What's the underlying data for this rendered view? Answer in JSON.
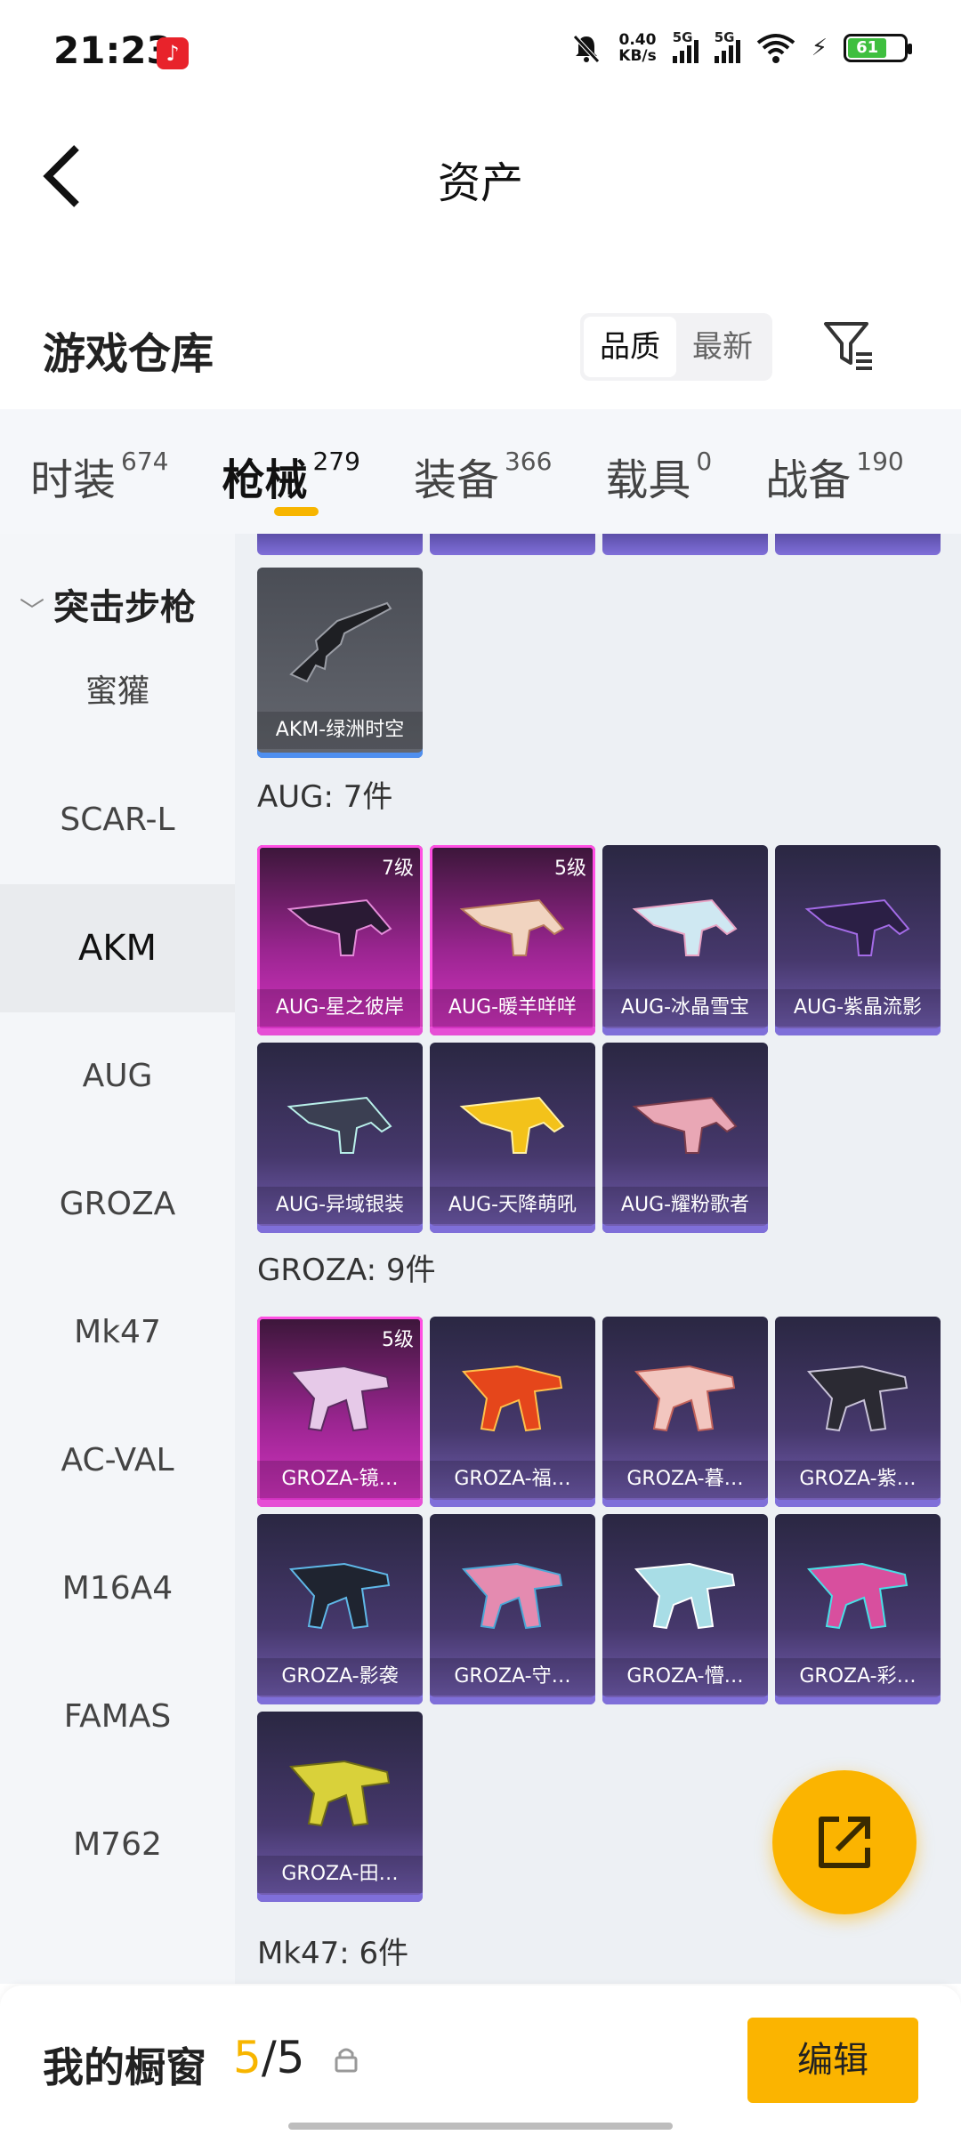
{
  "status_bar": {
    "time": "21:23",
    "net_speed_value": "0.40",
    "net_speed_unit": "KB/s",
    "sim1_label": "5G",
    "sim2_label": "5G",
    "battery_level": "61"
  },
  "header": {
    "title": "资产"
  },
  "warehouse": {
    "title": "游戏仓库",
    "sort_options": [
      "品质",
      "最新"
    ],
    "sort_selected": "品质"
  },
  "tabs": [
    {
      "label": "时装",
      "count": "674"
    },
    {
      "label": "枪械",
      "count": "279"
    },
    {
      "label": "装备",
      "count": "366"
    },
    {
      "label": "载具",
      "count": "0"
    },
    {
      "label": "战备",
      "count": "190"
    }
  ],
  "active_tab": "枪械",
  "categories": {
    "group_title": "突击步枪",
    "items": [
      "蜜獾",
      "SCAR-L",
      "AKM",
      "AUG",
      "GROZA",
      "Mk47",
      "AC-VAL",
      "M16A4",
      "FAMAS",
      "M762"
    ],
    "active": "AKM"
  },
  "sections": [
    {
      "items": [
        {
          "name": "AKM-绿洲时空",
          "level": ""
        }
      ]
    },
    {
      "title": "AUG: 7件",
      "items": [
        {
          "name": "AUG-星之彼岸",
          "level": "7级",
          "rarity": "pink"
        },
        {
          "name": "AUG-暖羊咩咩",
          "level": "5级",
          "rarity": "pink"
        },
        {
          "name": "AUG-冰晶雪宝",
          "level": "",
          "rarity": "purple"
        },
        {
          "name": "AUG-紫晶流影",
          "level": "",
          "rarity": "purple"
        },
        {
          "name": "AUG-异域银装",
          "level": "",
          "rarity": "purple"
        },
        {
          "name": "AUG-天降萌吼",
          "level": "",
          "rarity": "purple"
        },
        {
          "name": "AUG-耀粉歌者",
          "level": "",
          "rarity": "purple"
        }
      ]
    },
    {
      "title": "GROZA: 9件",
      "items": [
        {
          "name": "GROZA-镜…",
          "level": "5级",
          "rarity": "pink"
        },
        {
          "name": "GROZA-福…",
          "level": "",
          "rarity": "purple"
        },
        {
          "name": "GROZA-暮…",
          "level": "",
          "rarity": "purple"
        },
        {
          "name": "GROZA-紫…",
          "level": "",
          "rarity": "purple"
        },
        {
          "name": "GROZA-影袭",
          "level": "",
          "rarity": "purple"
        },
        {
          "name": "GROZA-守…",
          "level": "",
          "rarity": "purple"
        },
        {
          "name": "GROZA-懵…",
          "level": "",
          "rarity": "purple"
        },
        {
          "name": "GROZA-彩…",
          "level": "",
          "rarity": "purple"
        },
        {
          "name": "GROZA-田…",
          "level": "",
          "rarity": "purple"
        }
      ]
    },
    {
      "title": "Mk47: 6件",
      "items": []
    }
  ],
  "fab": {
    "icon": "share-external-icon"
  },
  "bottom_bar": {
    "label": "我的橱窗",
    "count_current": "5",
    "count_sep": "/",
    "count_total": "5",
    "edit_label": "编辑"
  },
  "colors": {
    "accent": "#fbb400",
    "pink_rarity": "#d734c4",
    "purple_rarity": "#7761b8"
  }
}
